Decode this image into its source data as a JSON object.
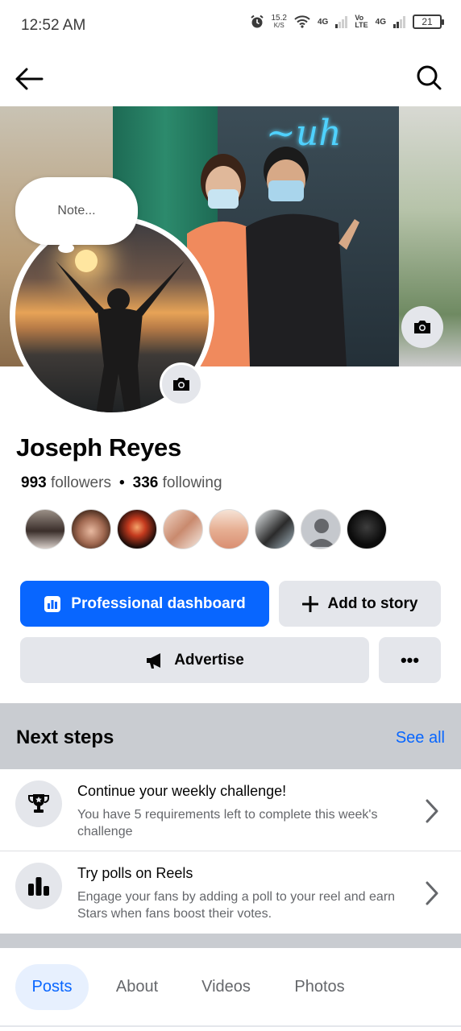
{
  "status_bar": {
    "time": "12:52 AM",
    "speed_value": "15.2",
    "speed_unit": "K/S",
    "net1": "4G",
    "volte_top": "Vo",
    "volte_bottom": "LTE",
    "net2": "4G",
    "battery": "21"
  },
  "topnav": {
    "back_icon": "arrow-left-icon",
    "search_icon": "search-icon"
  },
  "note": {
    "text": "Note..."
  },
  "profile": {
    "name": "Joseph Reyes",
    "followers_count": "993",
    "followers_label": "followers",
    "separator": "•",
    "following_count": "336",
    "following_label": "following"
  },
  "buttons": {
    "dashboard": "Professional dashboard",
    "story": "Add to story",
    "advertise": "Advertise",
    "more": "•••"
  },
  "next_steps": {
    "title": "Next steps",
    "see_all": "See all",
    "items": [
      {
        "title": "Continue your weekly challenge!",
        "description": "You have 5 requirements left to complete this week's challenge",
        "icon": "trophy-icon"
      },
      {
        "title": "Try polls on Reels",
        "description": "Engage your fans by adding a poll to your reel and earn Stars when fans boost their votes.",
        "icon": "bar-chart-icon"
      }
    ]
  },
  "tabs": [
    {
      "label": "Posts",
      "active": true
    },
    {
      "label": "About",
      "active": false
    },
    {
      "label": "Videos",
      "active": false
    },
    {
      "label": "Photos",
      "active": false
    }
  ],
  "colors": {
    "accent": "#0866ff",
    "button_gray": "#e4e6eb",
    "section_band": "#c9ccd1",
    "secondary_text": "#65676b"
  }
}
